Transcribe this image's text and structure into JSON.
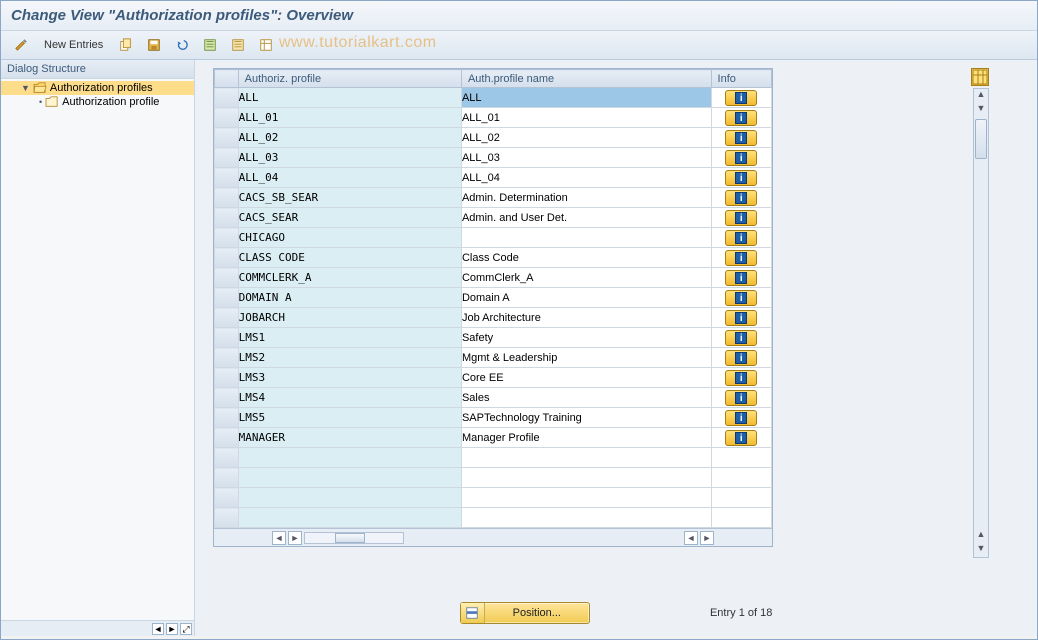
{
  "title": "Change View \"Authorization profiles\": Overview",
  "toolbar": {
    "new_entries": "New Entries"
  },
  "watermark": "www.tutorialkart.com",
  "dialog_structure": {
    "header": "Dialog Structure",
    "items": [
      {
        "label": "Authorization profiles",
        "selected": true,
        "expanded": true
      },
      {
        "label": "Authorization profile",
        "selected": false
      }
    ]
  },
  "table": {
    "columns": {
      "profile": "Authoriz. profile",
      "name": "Auth.profile name",
      "info": "Info"
    },
    "rows": [
      {
        "profile": "ALL",
        "name": "ALL",
        "highlight": true
      },
      {
        "profile": "ALL_01",
        "name": "ALL_01"
      },
      {
        "profile": "ALL_02",
        "name": "ALL_02"
      },
      {
        "profile": "ALL_03",
        "name": "ALL_03"
      },
      {
        "profile": "ALL_04",
        "name": "ALL_04"
      },
      {
        "profile": "CACS_SB_SEAR",
        "name": "Admin. Determination"
      },
      {
        "profile": "CACS_SEAR",
        "name": "Admin. and User Det."
      },
      {
        "profile": "CHICAGO",
        "name": ""
      },
      {
        "profile": "CLASS CODE",
        "name": "Class Code"
      },
      {
        "profile": "COMMCLERK_A",
        "name": "CommClerk_A"
      },
      {
        "profile": "DOMAIN A",
        "name": "Domain A"
      },
      {
        "profile": "JOBARCH",
        "name": "Job Architecture"
      },
      {
        "profile": "LMS1",
        "name": "Safety"
      },
      {
        "profile": "LMS2",
        "name": "Mgmt & Leadership"
      },
      {
        "profile": "LMS3",
        "name": "Core EE"
      },
      {
        "profile": "LMS4",
        "name": "Sales"
      },
      {
        "profile": "LMS5",
        "name": "SAPTechnology Training"
      },
      {
        "profile": "MANAGER",
        "name": "Manager Profile"
      }
    ],
    "empty_rows": 4
  },
  "footer": {
    "position_label": "Position...",
    "entry_text": "Entry 1 of 18"
  },
  "icons": {
    "info_char": "i"
  }
}
